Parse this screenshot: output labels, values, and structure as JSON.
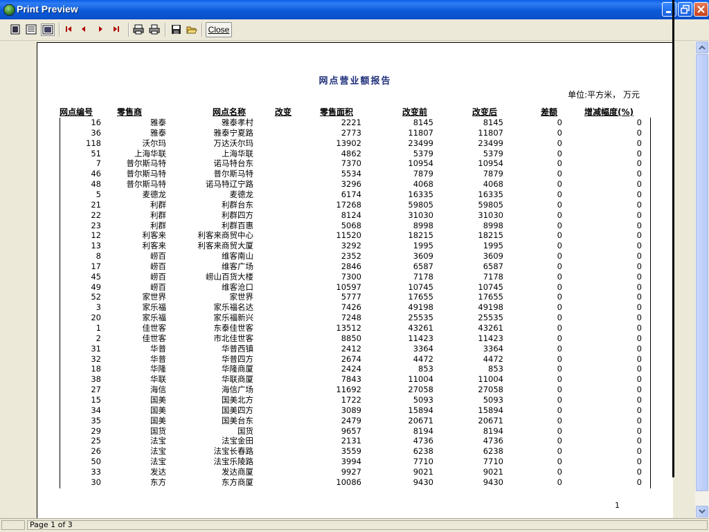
{
  "window": {
    "title": "Print Preview"
  },
  "toolbar": {
    "icons": [
      "one-page-icon",
      "multi-page-icon",
      "zoom-icon",
      "first-page-icon",
      "prev-page-icon",
      "next-page-icon",
      "last-page-icon",
      "print-setup-icon",
      "print-icon",
      "save-icon",
      "open-icon"
    ],
    "close_label": "Close"
  },
  "report": {
    "title": "网点营业额报告",
    "unit": "单位:平方米，  万元",
    "page_number": "1",
    "columns": [
      "网点编号",
      "零售商",
      "网点名称",
      "改变",
      "零售面积",
      "改变前",
      "改变后",
      "差额",
      "增减幅度(%)"
    ],
    "rows": [
      [
        "16",
        "雅泰",
        "雅泰孝村",
        "",
        "2221",
        "8145",
        "8145",
        "0",
        "0"
      ],
      [
        "36",
        "雅泰",
        "雅泰宁夏路",
        "",
        "2773",
        "11807",
        "11807",
        "0",
        "0"
      ],
      [
        "118",
        "沃尔玛",
        "万达沃尔玛",
        "",
        "13902",
        "23499",
        "23499",
        "0",
        "0"
      ],
      [
        "51",
        "上海华联",
        "上海华联",
        "",
        "4862",
        "5379",
        "5379",
        "0",
        "0"
      ],
      [
        "7",
        "普尔斯马特",
        "诺马特台东",
        "",
        "7370",
        "10954",
        "10954",
        "0",
        "0"
      ],
      [
        "46",
        "普尔斯马特",
        "普尔斯马特",
        "",
        "5534",
        "7879",
        "7879",
        "0",
        "0"
      ],
      [
        "48",
        "普尔斯马特",
        "诺马特辽宁路",
        "",
        "3296",
        "4068",
        "4068",
        "0",
        "0"
      ],
      [
        "5",
        "麦德龙",
        "麦德龙",
        "",
        "6174",
        "16335",
        "16335",
        "0",
        "0"
      ],
      [
        "21",
        "利群",
        "利群台东",
        "",
        "17268",
        "59805",
        "59805",
        "0",
        "0"
      ],
      [
        "22",
        "利群",
        "利群四方",
        "",
        "8124",
        "31030",
        "31030",
        "0",
        "0"
      ],
      [
        "23",
        "利群",
        "利群百惠",
        "",
        "5068",
        "8998",
        "8998",
        "0",
        "0"
      ],
      [
        "12",
        "利客来",
        "利客来商贸中心",
        "",
        "11520",
        "18215",
        "18215",
        "0",
        "0"
      ],
      [
        "13",
        "利客来",
        "利客来商贸大厦",
        "",
        "3292",
        "1995",
        "1995",
        "0",
        "0"
      ],
      [
        "8",
        "崂百",
        "维客南山",
        "",
        "2352",
        "3609",
        "3609",
        "0",
        "0"
      ],
      [
        "17",
        "崂百",
        "维客广场",
        "",
        "2846",
        "6587",
        "6587",
        "0",
        "0"
      ],
      [
        "45",
        "崂百",
        "崂山百货大楼",
        "",
        "7300",
        "7178",
        "7178",
        "0",
        "0"
      ],
      [
        "49",
        "崂百",
        "维客沧口",
        "",
        "10597",
        "10745",
        "10745",
        "0",
        "0"
      ],
      [
        "52",
        "家世界",
        "家世界",
        "",
        "5777",
        "17655",
        "17655",
        "0",
        "0"
      ],
      [
        "3",
        "家乐福",
        "家乐福名达",
        "",
        "7426",
        "49198",
        "49198",
        "0",
        "0"
      ],
      [
        "20",
        "家乐福",
        "家乐福新兴",
        "",
        "7248",
        "25535",
        "25535",
        "0",
        "0"
      ],
      [
        "1",
        "佳世客",
        "东泰佳世客",
        "",
        "13512",
        "43261",
        "43261",
        "0",
        "0"
      ],
      [
        "2",
        "佳世客",
        "市北佳世客",
        "",
        "8850",
        "11423",
        "11423",
        "0",
        "0"
      ],
      [
        "31",
        "华普",
        "华普西镇",
        "",
        "2412",
        "3364",
        "3364",
        "0",
        "0"
      ],
      [
        "32",
        "华普",
        "华普四方",
        "",
        "2674",
        "4472",
        "4472",
        "0",
        "0"
      ],
      [
        "18",
        "华隆",
        "华隆商厦",
        "",
        "2424",
        "853",
        "853",
        "0",
        "0"
      ],
      [
        "38",
        "华联",
        "华联商厦",
        "",
        "7843",
        "11004",
        "11004",
        "0",
        "0"
      ],
      [
        "27",
        "海信",
        "海信广场",
        "",
        "11692",
        "27058",
        "27058",
        "0",
        "0"
      ],
      [
        "15",
        "国美",
        "国美北方",
        "",
        "1722",
        "5093",
        "5093",
        "0",
        "0"
      ],
      [
        "34",
        "国美",
        "国美四方",
        "",
        "3089",
        "15894",
        "15894",
        "0",
        "0"
      ],
      [
        "35",
        "国美",
        "国美台东",
        "",
        "2479",
        "20671",
        "20671",
        "0",
        "0"
      ],
      [
        "29",
        "国货",
        "国货",
        "",
        "9657",
        "8194",
        "8194",
        "0",
        "0"
      ],
      [
        "25",
        "法宝",
        "法宝金田",
        "",
        "2131",
        "4736",
        "4736",
        "0",
        "0"
      ],
      [
        "26",
        "法宝",
        "法宝长春路",
        "",
        "3559",
        "6238",
        "6238",
        "0",
        "0"
      ],
      [
        "50",
        "法宝",
        "法宝乐陵路",
        "",
        "3994",
        "7710",
        "7710",
        "0",
        "0"
      ],
      [
        "33",
        "发达",
        "发达商厦",
        "",
        "9927",
        "9021",
        "9021",
        "0",
        "0"
      ],
      [
        "30",
        "东方",
        "东方商厦",
        "",
        "10086",
        "9430",
        "9430",
        "0",
        "0"
      ]
    ]
  },
  "status": {
    "page_text": "Page 1 of 3"
  }
}
